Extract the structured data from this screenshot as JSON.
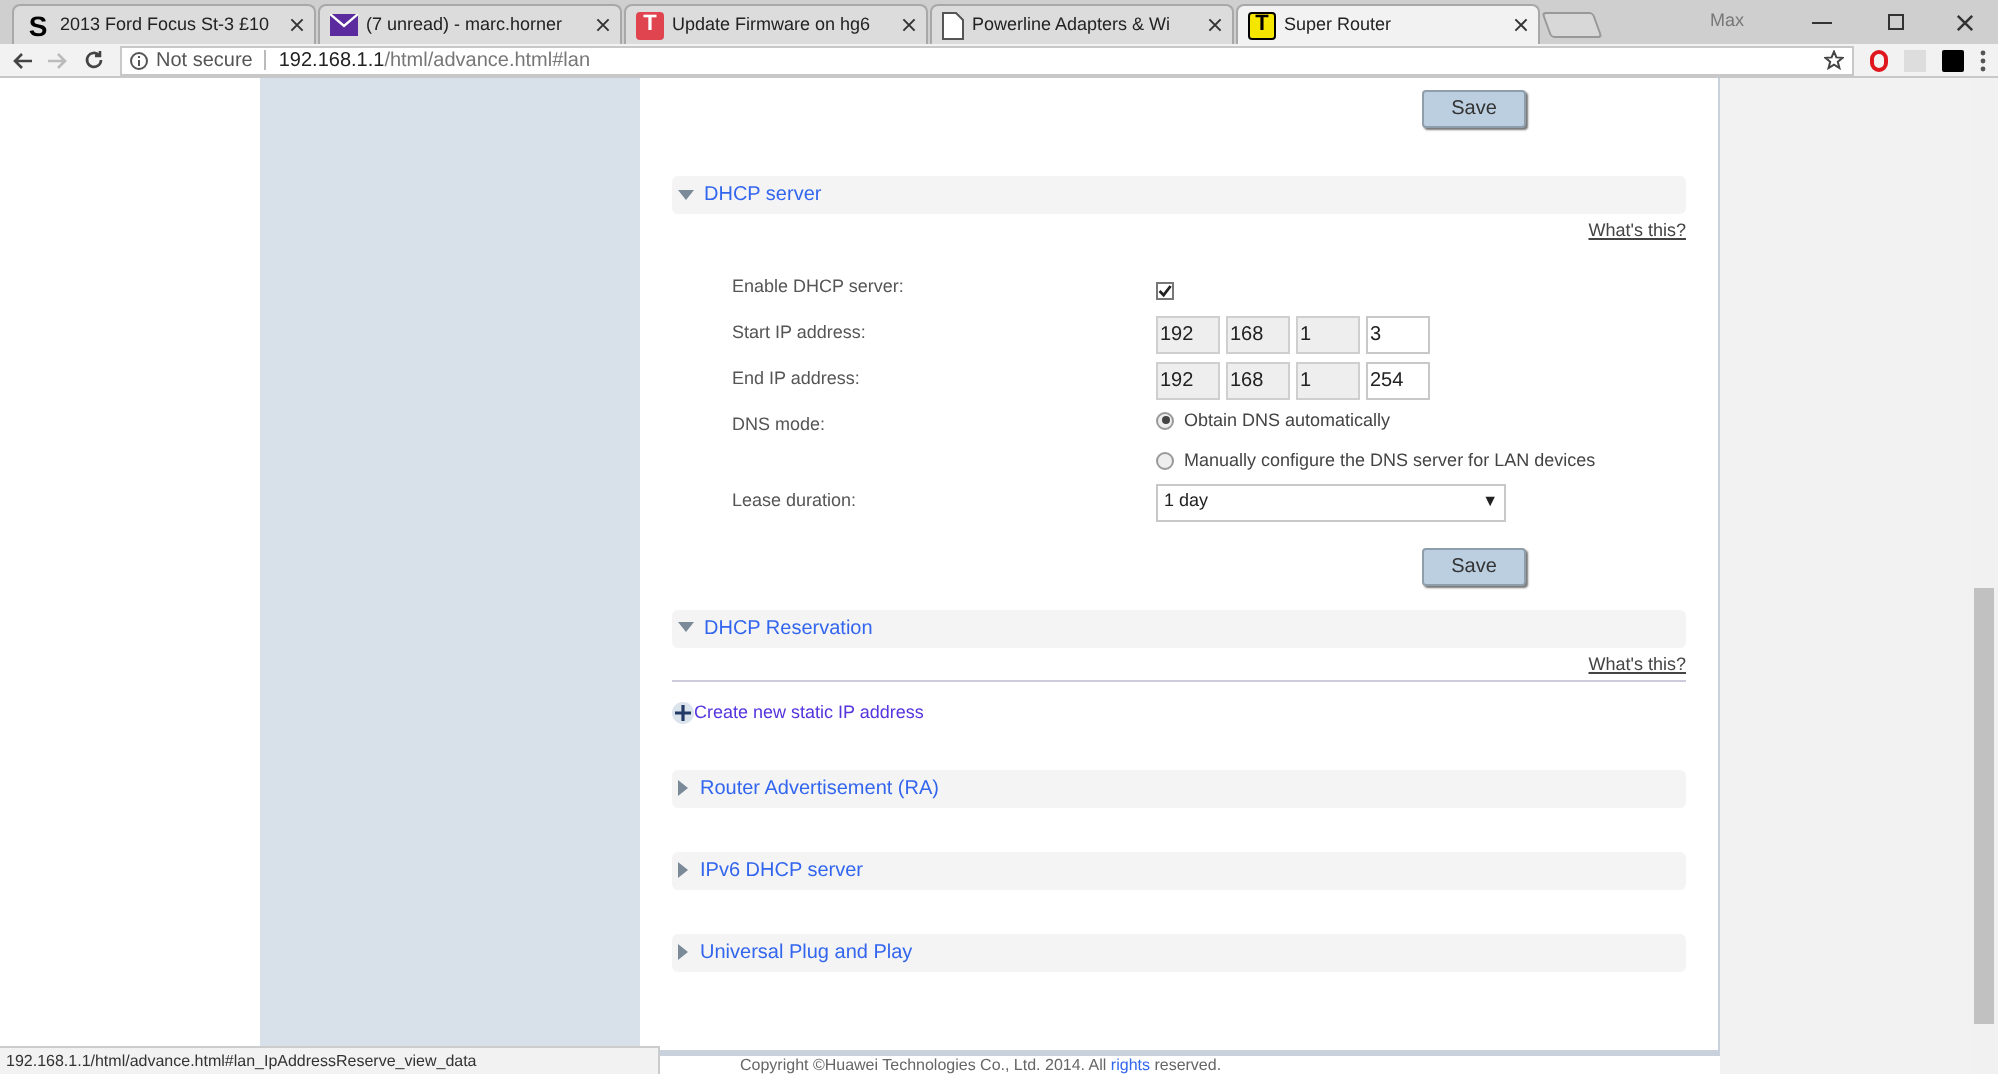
{
  "browser": {
    "tabs": [
      {
        "title": "2013 Ford Focus St-3 £10",
        "favicon": {
          "kind": "letter-plain",
          "text": "S"
        },
        "selected": false
      },
      {
        "title": "(7 unread) - marc.horner",
        "favicon": {
          "kind": "mail"
        },
        "selected": false
      },
      {
        "title": "Update Firmware on hg6",
        "favicon": {
          "kind": "letter-red",
          "text": "T"
        },
        "selected": false
      },
      {
        "title": "Powerline Adapters & Wi",
        "favicon": {
          "kind": "page"
        },
        "selected": false
      },
      {
        "title": "Super Router",
        "favicon": {
          "kind": "letter-yellow",
          "text": "T"
        },
        "selected": true
      }
    ],
    "profile": "Max",
    "address": {
      "security": "Not secure",
      "host": "192.168.1.1",
      "path": "/html/advance.html#lan"
    }
  },
  "top_save": "Save",
  "dhcp_server": {
    "title": "DHCP server",
    "expanded": true,
    "help": "What's this?",
    "rows": [
      {
        "kind": "checkbox",
        "label": "Enable DHCP server:",
        "checked": true
      },
      {
        "kind": "ip",
        "label": "Start IP address:",
        "octets": [
          {
            "value": "192",
            "disabled": true
          },
          {
            "value": "168",
            "disabled": true
          },
          {
            "value": "1",
            "disabled": true
          },
          {
            "value": "3",
            "disabled": false
          }
        ]
      },
      {
        "kind": "ip",
        "label": "End IP address:",
        "octets": [
          {
            "value": "192",
            "disabled": true
          },
          {
            "value": "168",
            "disabled": true
          },
          {
            "value": "1",
            "disabled": true
          },
          {
            "value": "254",
            "disabled": false
          }
        ]
      },
      {
        "kind": "radio",
        "label": "DNS mode:",
        "options": [
          {
            "label": "Obtain DNS automatically",
            "selected": true
          },
          {
            "label": "Manually configure the DNS server for LAN devices",
            "selected": false
          }
        ]
      },
      {
        "kind": "select",
        "label": "Lease duration:",
        "value": "1 day",
        "arrow": "▼"
      }
    ],
    "save": "Save"
  },
  "dhcp_reservation": {
    "title": "DHCP Reservation",
    "expanded": true,
    "help": "What's this?",
    "create": "Create new static IP address"
  },
  "collapsed_sections": [
    {
      "title": "Router Advertisement (RA)",
      "expanded": false
    },
    {
      "title": "IPv6 DHCP server",
      "expanded": false
    },
    {
      "title": "Universal Plug and Play",
      "expanded": false
    }
  ],
  "footer": {
    "before": "Copyright ©Huawei Technologies Co., Ltd. 2014. All ",
    "link": "rights",
    "after": " reserved."
  },
  "status_bar": "192.168.1.1/html/advance.html#lan_IpAddressReserve_view_data"
}
